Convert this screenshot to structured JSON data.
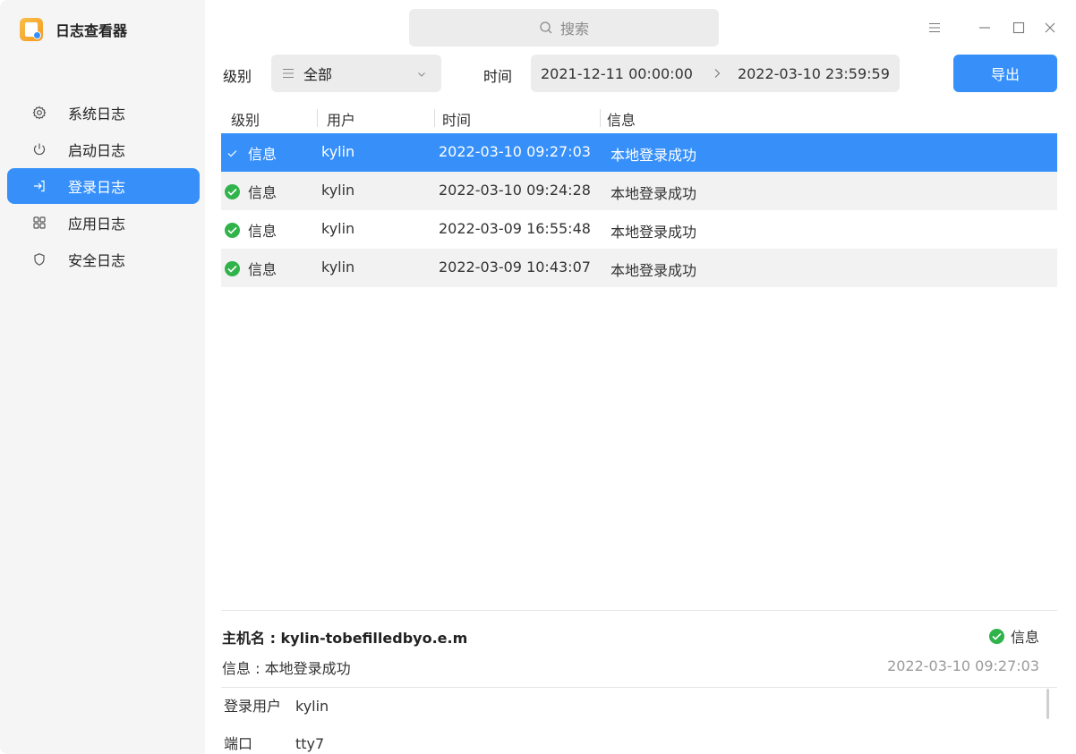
{
  "app": {
    "title": "日志查看器",
    "icon": "log-viewer-app-icon"
  },
  "sidebar": {
    "items": [
      {
        "label": "系统日志",
        "icon": "gear-icon",
        "active": false
      },
      {
        "label": "启动日志",
        "icon": "power-icon",
        "active": false
      },
      {
        "label": "登录日志",
        "icon": "login-icon",
        "active": true
      },
      {
        "label": "应用日志",
        "icon": "apps-grid-icon",
        "active": false
      },
      {
        "label": "安全日志",
        "icon": "shield-icon",
        "active": false
      }
    ]
  },
  "search": {
    "placeholder": "搜索",
    "icon": "search-icon"
  },
  "window_controls": {
    "menu": "menu-icon",
    "minimize": "minimize-icon",
    "maximize": "maximize-icon",
    "close": "close-icon"
  },
  "filters": {
    "level_label": "级别",
    "level_value": "全部",
    "time_label": "时间",
    "start_time": "2021-12-11 00:00:00",
    "end_time": "2022-03-10 23:59:59",
    "export_label": "导出"
  },
  "table": {
    "columns": [
      "级别",
      "用户",
      "时间",
      "信息"
    ],
    "rows": [
      {
        "level": "信息",
        "user": "kylin",
        "time": "2022-03-10 09:27:03",
        "info": "本地登录成功",
        "selected": true
      },
      {
        "level": "信息",
        "user": "kylin",
        "time": "2022-03-10 09:24:28",
        "info": "本地登录成功",
        "selected": false
      },
      {
        "level": "信息",
        "user": "kylin",
        "time": "2022-03-09 16:55:48",
        "info": "本地登录成功",
        "selected": false
      },
      {
        "level": "信息",
        "user": "kylin",
        "time": "2022-03-09 10:43:07",
        "info": "本地登录成功",
        "selected": false
      }
    ]
  },
  "detail": {
    "host": "主机名 : kylin-tobefilledbyo.e.m",
    "info": "信息 : 本地登录成功",
    "level": "信息",
    "time": "2022-03-10 09:27:03",
    "fields": [
      {
        "key": "登录用户",
        "value": "kylin"
      },
      {
        "key": "端口",
        "value": "tty7"
      }
    ]
  },
  "colors": {
    "accent": "#3790fa",
    "success": "#2fb34a",
    "sidebar_bg": "#f5f5f5"
  }
}
